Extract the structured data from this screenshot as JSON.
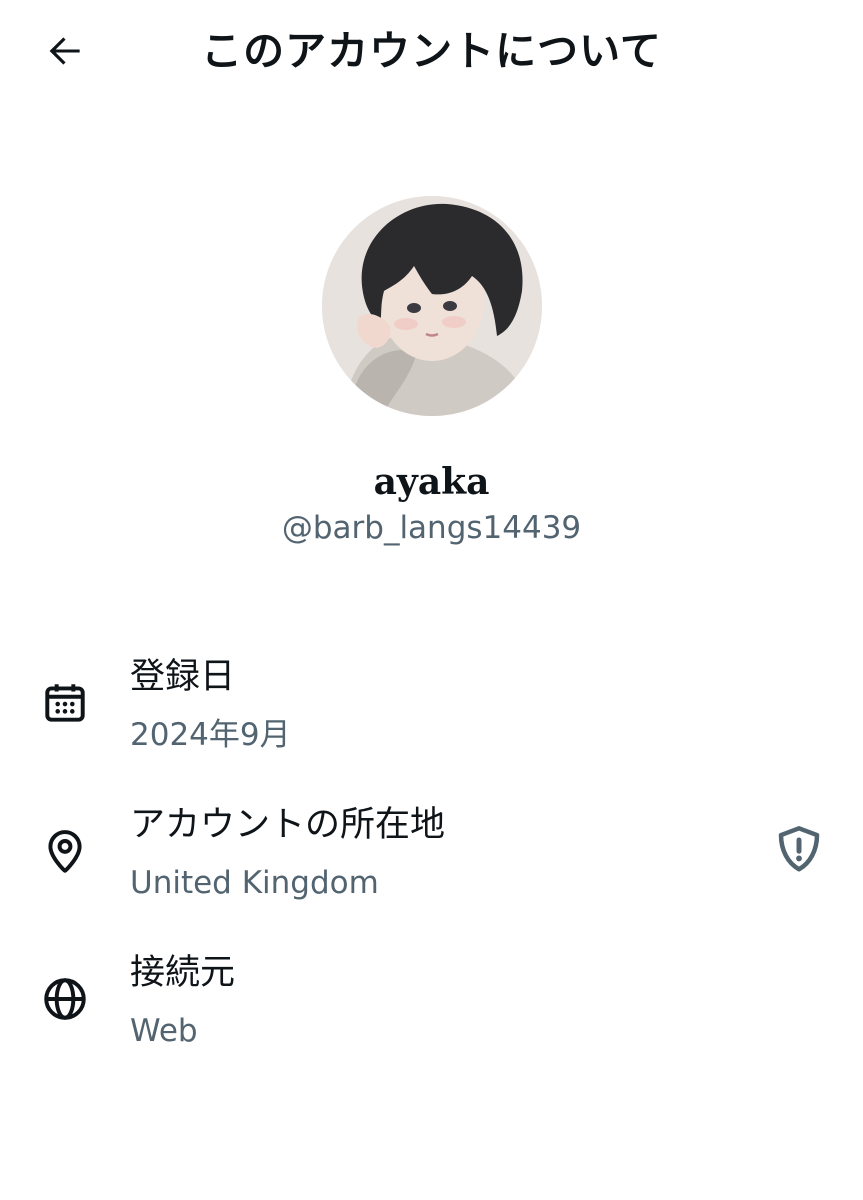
{
  "header": {
    "title": "このアカウントについて",
    "back_icon": "arrow-left-icon"
  },
  "profile": {
    "display_name": "ayaka",
    "handle": "@barb_langs14439"
  },
  "details": [
    {
      "icon": "calendar-icon",
      "label": "登録日",
      "value": "2024年9月"
    },
    {
      "icon": "location-pin-icon",
      "label": "アカウントの所在地",
      "value": "United Kingdom",
      "trailing_icon": "shield-alert-icon"
    },
    {
      "icon": "globe-icon",
      "label": "接続元",
      "value": "Web"
    }
  ],
  "colors": {
    "text_primary": "#0f1419",
    "text_secondary": "#536471"
  }
}
